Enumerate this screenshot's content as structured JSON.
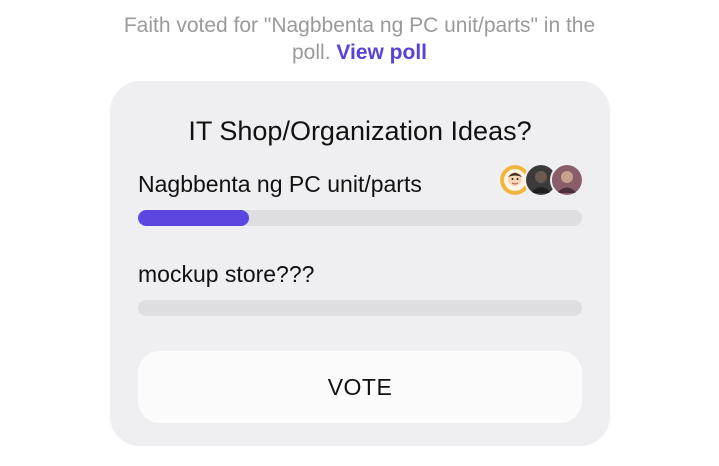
{
  "notice": {
    "line1": "Faith voted for \"Nagbbenta ng PC unit/parts\" in the",
    "line2": "poll. ",
    "link": "View poll"
  },
  "poll": {
    "title": "IT Shop/Organization Ideas?",
    "options": [
      {
        "label": "Nagbbenta ng PC unit/parts",
        "progress": 0.25,
        "voter_avatars": [
          "cartoon-avatar",
          "dark-photo-avatar",
          "photo-avatar"
        ]
      },
      {
        "label": "mockup store???",
        "progress": 0,
        "voter_avatars": []
      }
    ],
    "vote_label": "VOTE"
  },
  "colors": {
    "accent": "#5b46e0",
    "link": "#5a42d6",
    "card_bg": "#efeff1",
    "track": "#dedee2",
    "notice_text": "#9a9a9a"
  }
}
